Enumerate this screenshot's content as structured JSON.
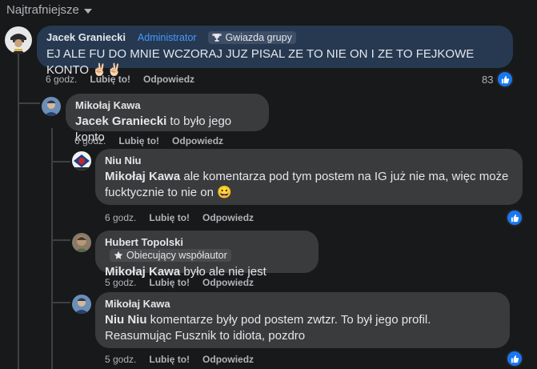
{
  "sort": {
    "label": "Najtrafniejsze"
  },
  "comments": [
    {
      "author": "Jacek Graniecki",
      "badges": [
        "Administrator",
        "Gwiazda grupy"
      ],
      "mention": "",
      "text": "EJ ALE FU DO MNIE WCZORAJ JUZ PISAL ZE TO NIE ON I ZE TO FEJKOWE KONTO ✌🏻✌🏻",
      "time": "6 godz.",
      "like": "Lubię to!",
      "reply": "Odpowiedz",
      "reactions": "83"
    },
    {
      "author": "Mikołaj Kawa",
      "mention": "Jacek Graniecki",
      "text": " to było jego konto",
      "time": "6 godz.",
      "like": "Lubię to!",
      "reply": "Odpowiedz"
    },
    {
      "author": "Niu Niu",
      "mention": "Mikołaj Kawa",
      "text": " ale komentarza pod tym postem na IG już nie ma, więc może fucktycznie to nie on 😀",
      "time": "6 godz.",
      "like": "Lubię to!",
      "reply": "Odpowiedz"
    },
    {
      "author": "Hubert Topolski",
      "badges": [
        "Obiecujący współautor"
      ],
      "mention": "Mikołaj Kawa",
      "text": " było ale nie jest",
      "time": "5 godz.",
      "like": "Lubię to!",
      "reply": "Odpowiedz"
    },
    {
      "author": "Mikołaj Kawa",
      "mention": "Niu Niu",
      "text": " komentarze były pod postem zwtzr. To był jego profil. Reasumując Fusznik to idiota, pozdro",
      "time": "5 godz.",
      "like": "Lubię to!",
      "reply": "Odpowiedz"
    }
  ],
  "colors": {
    "highlight": "#263951",
    "bubble": "#3a3b3c",
    "accent": "#1877f2"
  }
}
